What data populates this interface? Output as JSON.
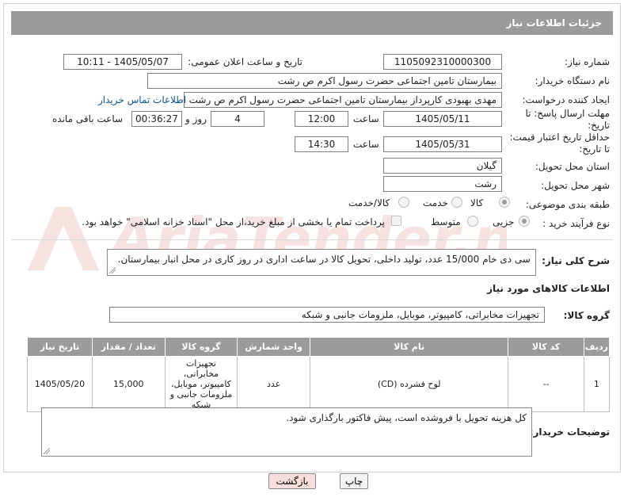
{
  "header": {
    "title": "جزئیات اطلاعات نیاز"
  },
  "fields": {
    "need_number": {
      "label": "شماره نیاز:",
      "value": "1105092310000300"
    },
    "announce_datetime": {
      "label": "تاریخ و ساعت اعلان عمومی:",
      "value": "1405/05/07 - 10:11"
    },
    "buyer_org": {
      "label": "نام دستگاه خریدار:",
      "value": "بیمارستان  تامین اجتماعی حضرت رسول اکرم ص رشت"
    },
    "requester": {
      "label": "ایجاد کننده درخواست:",
      "value": "مهدی بهبودی کارپرداز بیمارستان  تامین اجتماعی حضرت رسول اکرم ص رشت",
      "contact_link": "اطلاعات تماس خریدار"
    },
    "deadline": {
      "label": "مهلت ارسال پاسخ: تا تاریخ:",
      "date": "1405/05/11",
      "time_label": "ساعت",
      "time": "12:00",
      "days": "4",
      "days_label": "روز و",
      "remaining": "00:36:27",
      "remaining_label": "ساعت باقی مانده"
    },
    "price_validity": {
      "label": "حداقل تاریخ اعتبار قیمت: تا تاریخ:",
      "date": "1405/05/31",
      "time_label": "ساعت",
      "time": "14:30"
    },
    "province": {
      "label": "استان محل تحویل:",
      "value": "گیلان"
    },
    "city": {
      "label": "شهر محل تحویل:",
      "value": "رشت"
    },
    "category": {
      "label": "طبقه بندی موضوعی:",
      "options": [
        "کالا",
        "خدمت",
        "کالا/خدمت"
      ],
      "selected": 0
    },
    "process": {
      "label": "نوع فرآیند خرید :",
      "options": [
        "جزیی",
        "متوسط"
      ],
      "selected": 0,
      "payment_note": "پرداخت تمام یا بخشی از مبلغ خرید،از محل \"اسناد خزانه اسلامی\" خواهد بود."
    }
  },
  "description": {
    "label": "شرح کلی نیاز:",
    "value": "سی دی خام 15/000 عدد، تولید داخلی، تحویل کالا در ساعت اداری در روز کاری در محل انبار بیمارستان."
  },
  "goods_section": {
    "title": "اطلاعات کالاهای مورد نیاز",
    "group_label": "گروه کالا:",
    "group_value": "تجهیزات مخابراتی، کامپیوتر، موبایل، ملزومات جانبی و شبکه"
  },
  "table": {
    "headers": [
      "ردیف",
      "کد کالا",
      "نام کالا",
      "واحد شمارش",
      "گروه کالا",
      "تعداد / مقدار",
      "تاریخ نیاز"
    ],
    "rows": [
      [
        "1",
        "--",
        "لوح فشرده (CD)",
        "عدد",
        "تجهیزات مخابراتی، کامپیوتر، موبایل، ملزومات جانبی و شبکه",
        "15,000",
        "1405/05/20"
      ]
    ]
  },
  "buyer_notes": {
    "label": "توضیحات خریدار:",
    "value": "کل هزینه تحویل با فروشده است، پیش فاکتور بارگذاری شود."
  },
  "buttons": {
    "print": "چاپ",
    "back": "بازگشت"
  },
  "colors": {
    "header_bg": "#9b9b9b",
    "link": "#0b5394",
    "back_button_bg": "#f9dede",
    "watermark": "#d32f2f"
  }
}
